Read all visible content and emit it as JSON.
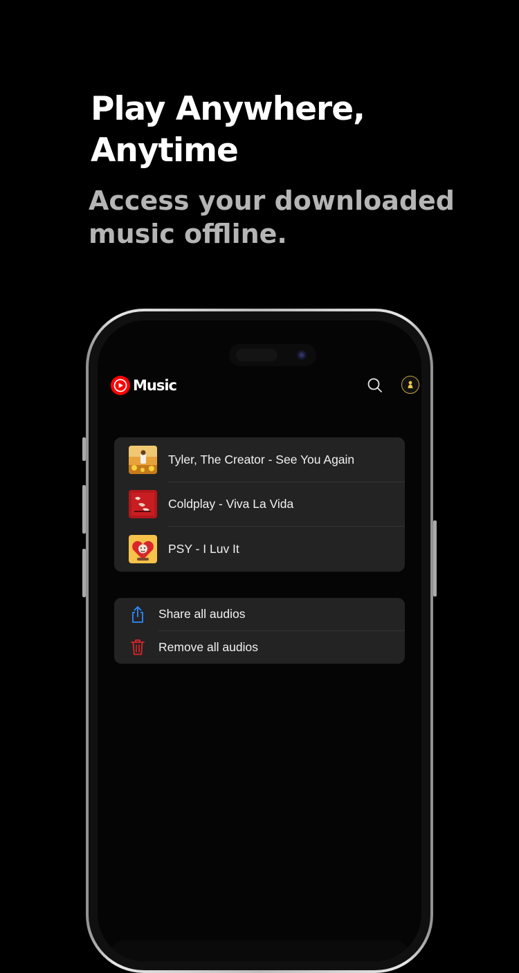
{
  "promo": {
    "headline": [
      "Play Anywhere,",
      "Anytime"
    ],
    "subheadline": [
      "Access your downloaded",
      "music offline."
    ]
  },
  "app": {
    "logo_text": "Music",
    "brand_color": "#ff0000",
    "header_icons": [
      "search-icon",
      "avatar"
    ]
  },
  "songs": [
    {
      "title": "Tyler, The Creator - See You Again",
      "thumb": "album-art-tyler"
    },
    {
      "title": "Coldplay - Viva La Vida",
      "thumb": "album-art-coldplay"
    },
    {
      "title": "PSY - I Luv It",
      "thumb": "album-art-psy"
    }
  ],
  "actions": [
    {
      "label": "Share all audios",
      "icon": "share-icon",
      "color": "#2e8bff"
    },
    {
      "label": "Remove all audios",
      "icon": "trash-icon",
      "color": "#e0242a"
    }
  ]
}
